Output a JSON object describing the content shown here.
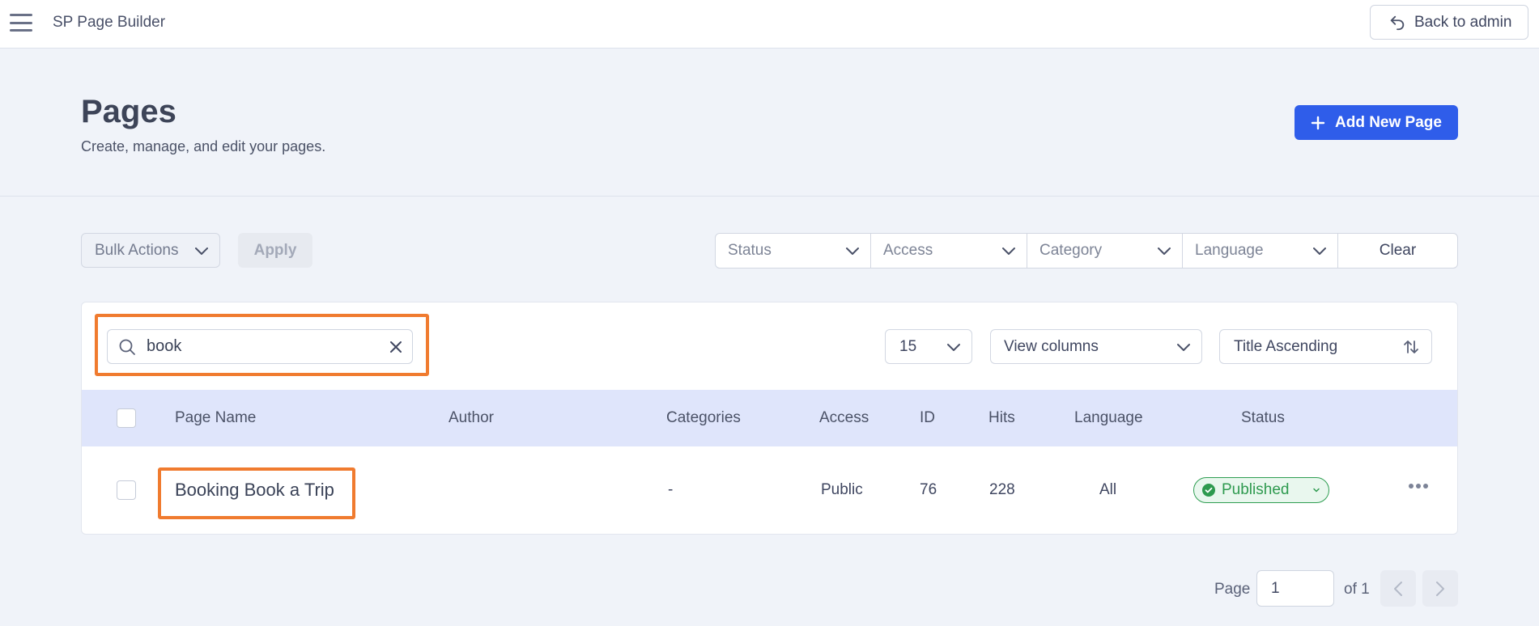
{
  "topbar": {
    "app_title": "SP Page Builder",
    "back_label": "Back to admin"
  },
  "header": {
    "title": "Pages",
    "subtitle": "Create, manage, and edit your pages.",
    "add_label": "Add New Page"
  },
  "toolbar": {
    "bulk_label": "Bulk Actions",
    "apply_label": "Apply",
    "filters": {
      "status": "Status",
      "access": "Access",
      "category": "Category",
      "language": "Language",
      "clear": "Clear"
    }
  },
  "search": {
    "value": "book",
    "placeholder": ""
  },
  "controls": {
    "per_page": "15",
    "view_columns": "View columns",
    "sort": "Title Ascending"
  },
  "table": {
    "headers": {
      "name": "Page Name",
      "author": "Author",
      "categories": "Categories",
      "access": "Access",
      "id": "ID",
      "hits": "Hits",
      "language": "Language",
      "status": "Status"
    },
    "rows": [
      {
        "name": "Booking Book a Trip",
        "author": "",
        "categories": "-",
        "access": "Public",
        "id": "76",
        "hits": "228",
        "language": "All",
        "status": "Published"
      }
    ]
  },
  "pagination": {
    "page_label": "Page",
    "current_page": "1",
    "of_label": "of 1"
  },
  "colors": {
    "accent": "#2f5dea",
    "highlight": "#f07b2f",
    "published": "#2e9a4f",
    "header_row": "#dfe5fb",
    "background": "#f0f3f9"
  },
  "icons": {
    "menu": "hamburger-icon",
    "back": "back-arrow-icon",
    "add": "plus-icon",
    "search": "search-icon",
    "clear": "close-icon",
    "sort": "sort-arrows-icon",
    "status": "check-circle-icon",
    "more": "more-dots-icon"
  }
}
